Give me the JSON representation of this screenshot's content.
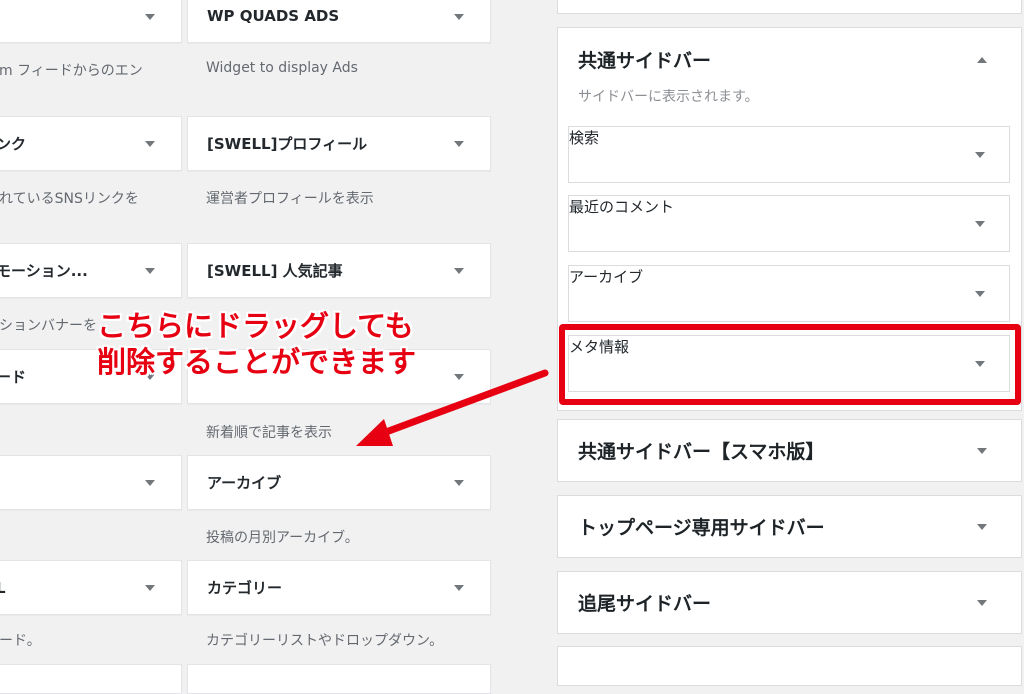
{
  "available_widgets": {
    "col_left": [
      {
        "title": "",
        "desc": "m フィードからのエン"
      },
      {
        "title": "ンク",
        "desc": "れているSNSリンクを"
      },
      {
        "title": "モーション...",
        "desc": "ションバナーを"
      },
      {
        "title": "ード",
        "desc": ""
      },
      {
        "title": "",
        "desc": ""
      },
      {
        "title": "L",
        "desc": "ード。"
      }
    ],
    "col_right": [
      {
        "title": "WP QUADS ADS",
        "desc": "Widget to display Ads"
      },
      {
        "title": "[SWELL]プロフィール",
        "desc": "運営者プロフィールを表示"
      },
      {
        "title": "[SWELL] 人気記事",
        "desc": ""
      },
      {
        "title": "",
        "desc": "新着順で記事を表示"
      },
      {
        "title": "アーカイブ",
        "desc": "投稿の月別アーカイブ。"
      },
      {
        "title": "カテゴリー",
        "desc": "カテゴリーリストやドロップダウン。"
      }
    ]
  },
  "sidebar_areas": {
    "common": {
      "title": "共通サイドバー",
      "desc": "サイドバーに表示されます。",
      "widgets": [
        "検索",
        "最近のコメント",
        "アーカイブ",
        "メタ情報"
      ]
    },
    "others": [
      "共通サイドバー【スマホ版】",
      "トップページ専用サイドバー",
      "追尾サイドバー"
    ]
  },
  "annotation": {
    "line1": "こちらにドラッグしても",
    "line2": "削除することができます",
    "color": "#e60012"
  }
}
